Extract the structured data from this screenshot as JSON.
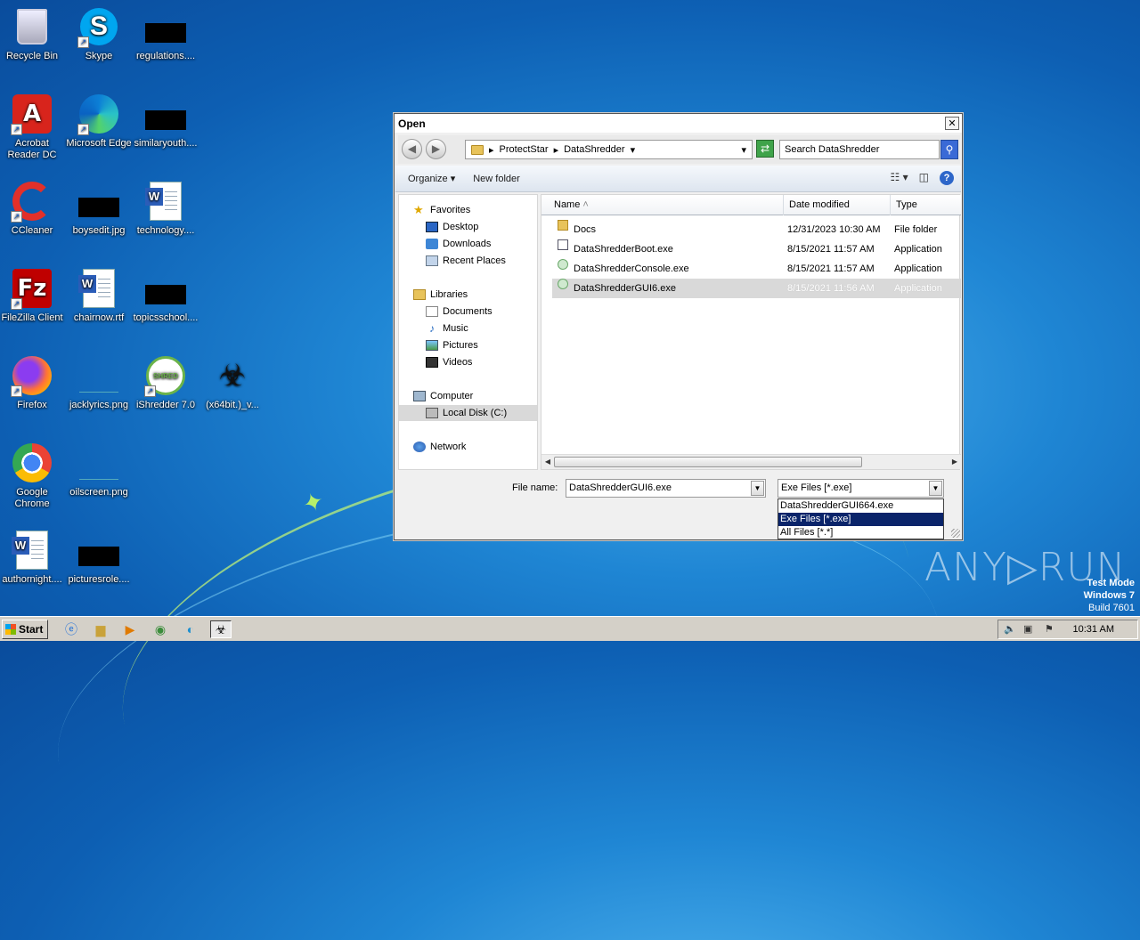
{
  "desktop": {
    "icons": [
      {
        "label": "Recycle Bin",
        "icon": "recycle-bin-icon"
      },
      {
        "label": "Skype",
        "icon": "skype-icon"
      },
      {
        "label": "regulations....",
        "icon": "redacted-file-icon"
      },
      {
        "label": "Acrobat Reader DC",
        "icon": "acrobat-icon"
      },
      {
        "label": "Microsoft Edge",
        "icon": "edge-icon"
      },
      {
        "label": "similaryouth....",
        "icon": "redacted-file-icon"
      },
      {
        "label": "CCleaner",
        "icon": "ccleaner-icon"
      },
      {
        "label": "boysedit.jpg",
        "icon": "redacted-file-icon"
      },
      {
        "label": "technology....",
        "icon": "word-doc-icon"
      },
      {
        "label": "FileZilla Client",
        "icon": "filezilla-icon"
      },
      {
        "label": "chairnow.rtf",
        "icon": "word-doc-icon"
      },
      {
        "label": "topicsschool....",
        "icon": "redacted-file-icon"
      },
      {
        "label": "Firefox",
        "icon": "firefox-icon"
      },
      {
        "label": "jacklyrics.png",
        "icon": "image-file-icon"
      },
      {
        "label": "iShredder 7.0",
        "icon": "ishredder-icon"
      },
      {
        "label": "(x64bit.)_v...",
        "icon": "hazard-installer-icon"
      },
      {
        "label": "Google Chrome",
        "icon": "chrome-icon"
      },
      {
        "label": "oilscreen.png",
        "icon": "image-file-icon"
      },
      {
        "label": "authornight....",
        "icon": "word-doc-icon"
      },
      {
        "label": "picturesrole....",
        "icon": "redacted-file-icon"
      }
    ]
  },
  "dialog": {
    "title": "Open",
    "close_glyph": "✕",
    "breadcrumb": [
      "ProtectStar",
      "DataShredder"
    ],
    "search_placeholder": "Search DataShredder",
    "toolbar": {
      "organize": "Organize",
      "new_folder": "New folder"
    },
    "nav": {
      "favorites": "Favorites",
      "desktop": "Desktop",
      "downloads": "Downloads",
      "recent": "Recent Places",
      "libraries": "Libraries",
      "documents": "Documents",
      "music": "Music",
      "pictures": "Pictures",
      "videos": "Videos",
      "computer": "Computer",
      "local_disk": "Local Disk (C:)",
      "network": "Network"
    },
    "columns": {
      "name": "Name",
      "date": "Date modified",
      "type": "Type"
    },
    "files": [
      {
        "name": "Docs",
        "date": "12/31/2023 10:30 AM",
        "type": "File folder"
      },
      {
        "name": "DataShredderBoot.exe",
        "date": "8/15/2021 11:57 AM",
        "type": "Application"
      },
      {
        "name": "DataShredderConsole.exe",
        "date": "8/15/2021 11:57 AM",
        "type": "Application"
      },
      {
        "name": "DataShredderGUI6.exe",
        "date": "8/15/2021 11:56 AM",
        "type": "Application"
      }
    ],
    "file_name_label": "File name:",
    "file_name_value": "DataShredderGUI6.exe",
    "file_type_value": "Exe Files [*.exe]",
    "file_type_options": [
      "DataShredderGUI664.exe",
      "Exe Files [*.exe]",
      "All Files [*.*]"
    ]
  },
  "watermark": {
    "brand": "ANY▷RUN",
    "line1": "Test Mode",
    "line2": "Windows 7",
    "line3": "Build 7601"
  },
  "taskbar": {
    "start_label": "Start",
    "clock": "10:31 AM"
  }
}
